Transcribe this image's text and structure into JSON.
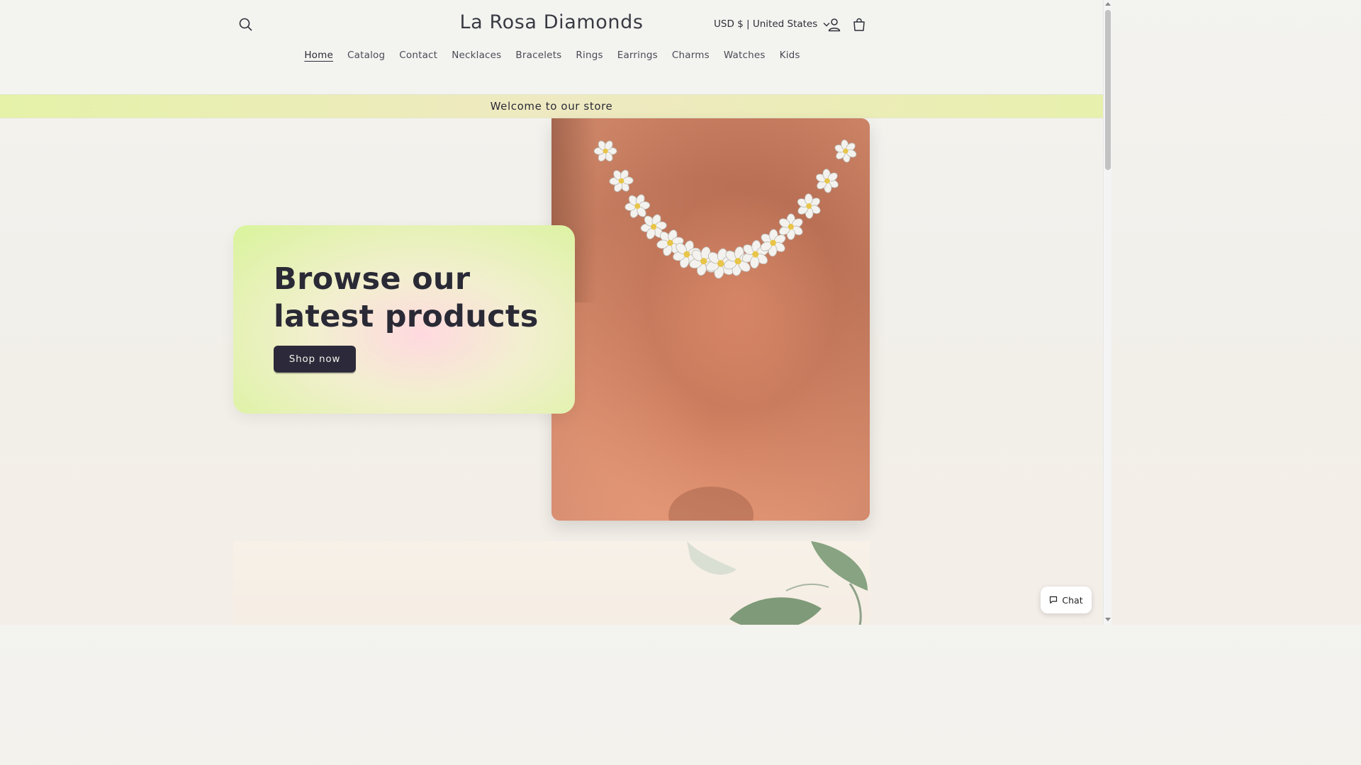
{
  "header": {
    "logo": "La Rosa Diamonds",
    "currency": "USD $ | United States",
    "icons": {
      "search": "search-icon",
      "account": "account-icon",
      "cart": "cart-icon"
    }
  },
  "nav": {
    "items": [
      {
        "label": "Home",
        "active": true
      },
      {
        "label": "Catalog"
      },
      {
        "label": "Contact"
      },
      {
        "label": "Necklaces"
      },
      {
        "label": "Bracelets"
      },
      {
        "label": "Rings"
      },
      {
        "label": "Earrings"
      },
      {
        "label": "Charms"
      },
      {
        "label": "Watches"
      },
      {
        "label": "Kids"
      }
    ]
  },
  "announcement": {
    "text": "Welcome to our store"
  },
  "hero": {
    "title": "Browse our latest products",
    "button_label": "Shop now",
    "image": "flower-diamond-necklace-photo"
  },
  "chat": {
    "label": "Chat",
    "icon": "chat-bubble-icon"
  },
  "colors": {
    "accent_dark": "#2c2a3a",
    "announcement_bg": "#e5f2a8",
    "card_green": "#d9f49b",
    "card_pink": "#ffd9e0"
  }
}
